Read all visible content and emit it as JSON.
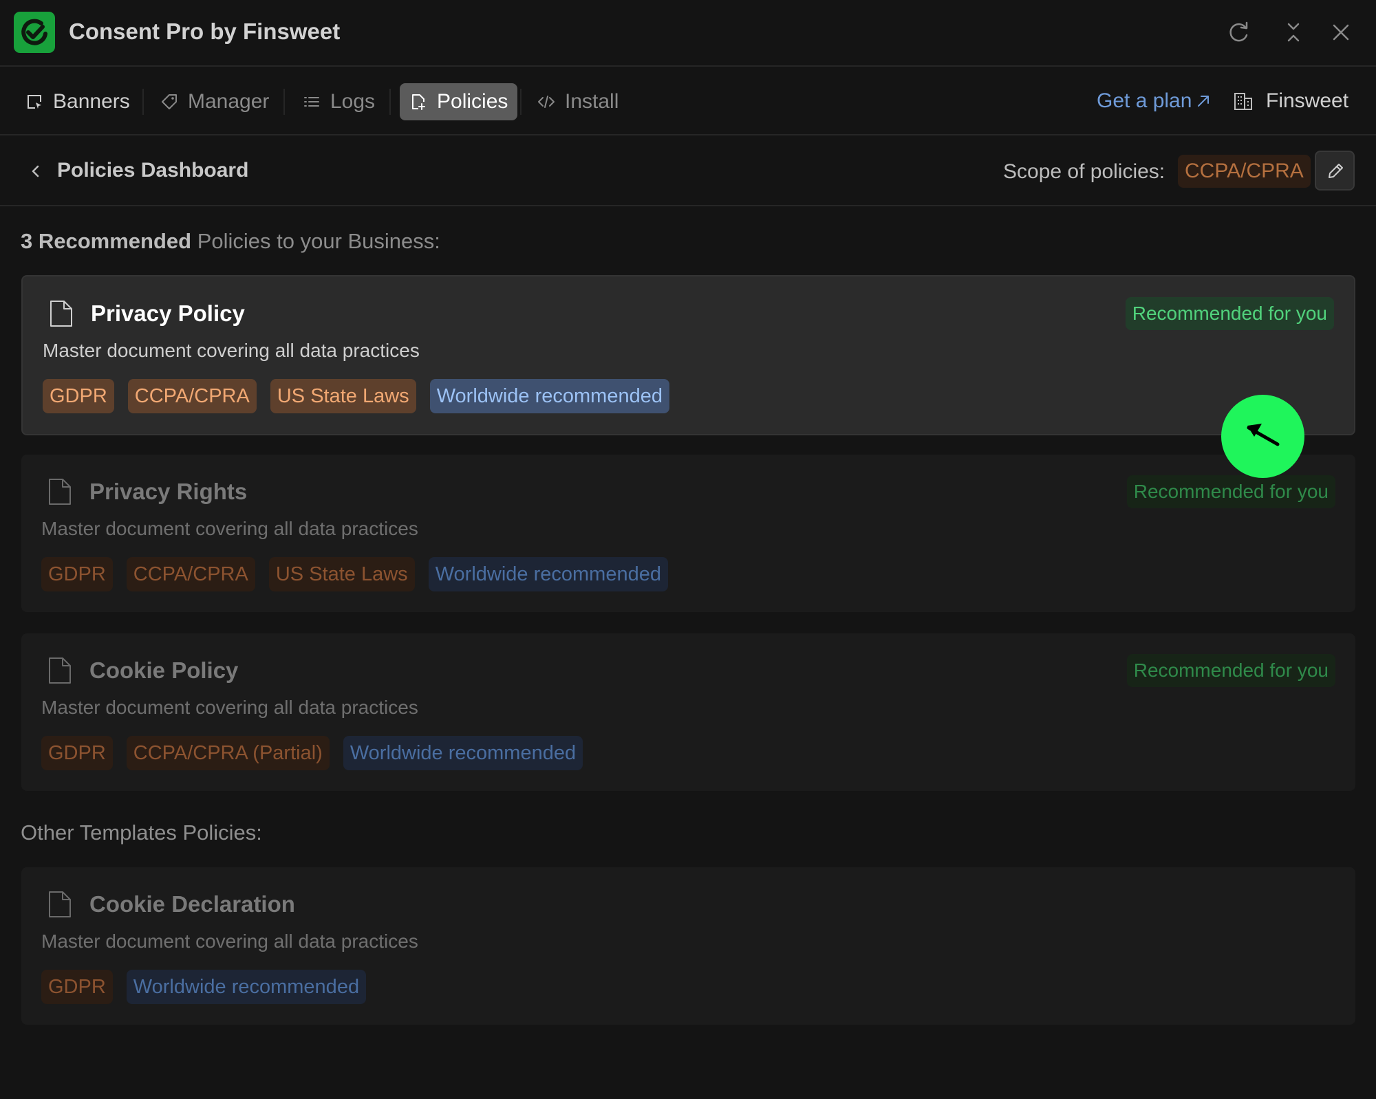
{
  "app": {
    "title": "Consent Pro by Finsweet",
    "logo_icon": "check-logo-icon",
    "brand_color": "#18a13b"
  },
  "window_controls": {
    "refresh_icon": "refresh-icon",
    "collapse_icon": "collapse-icon",
    "close_icon": "close-icon"
  },
  "tabs": [
    {
      "label": "Banners",
      "icon": "banner-icon",
      "active": false
    },
    {
      "label": "Manager",
      "icon": "tag-icon",
      "active": false
    },
    {
      "label": "Logs",
      "icon": "list-icon",
      "active": false
    },
    {
      "label": "Policies",
      "icon": "document-plus-icon",
      "active": true
    },
    {
      "label": "Install",
      "icon": "code-icon",
      "active": false
    }
  ],
  "header_right": {
    "get_plan": "Get a plan",
    "workspace": "Finsweet"
  },
  "subheader": {
    "title": "Policies Dashboard",
    "scope_label": "Scope of policies:",
    "scope_value": "CCPA/CPRA"
  },
  "recommended_heading": {
    "count": "3 Recommended",
    "rest": " Policies to your Business:"
  },
  "other_heading": "Other Templates Policies:",
  "policies": [
    {
      "title": "Privacy Policy",
      "description": "Master document covering all data practices",
      "badge": "Recommended for you",
      "tags": [
        {
          "label": "GDPR",
          "kind": "law"
        },
        {
          "label": "CCPA/CPRA",
          "kind": "law"
        },
        {
          "label": "US State Laws",
          "kind": "law"
        },
        {
          "label": "Worldwide recommended",
          "kind": "world"
        }
      ]
    },
    {
      "title": "Privacy Rights",
      "description": "Master document covering all data practices",
      "badge": "Recommended for you",
      "tags": [
        {
          "label": "GDPR",
          "kind": "law"
        },
        {
          "label": "CCPA/CPRA",
          "kind": "law"
        },
        {
          "label": "US State Laws",
          "kind": "law"
        },
        {
          "label": "Worldwide recommended",
          "kind": "world"
        }
      ]
    },
    {
      "title": "Cookie Policy",
      "description": "Master document covering all data practices",
      "badge": "Recommended for you",
      "tags": [
        {
          "label": "GDPR",
          "kind": "law"
        },
        {
          "label": "CCPA/CPRA (Partial)",
          "kind": "law"
        },
        {
          "label": "Worldwide recommended",
          "kind": "world"
        }
      ]
    }
  ],
  "other_policies": [
    {
      "title": "Cookie Declaration",
      "description": "Master document covering all data practices",
      "tags": [
        {
          "label": "GDPR",
          "kind": "law"
        },
        {
          "label": "Worldwide recommended",
          "kind": "world"
        }
      ]
    }
  ],
  "cursor": {
    "icon": "arrow-cursor-icon",
    "color": "#1ff55b"
  }
}
